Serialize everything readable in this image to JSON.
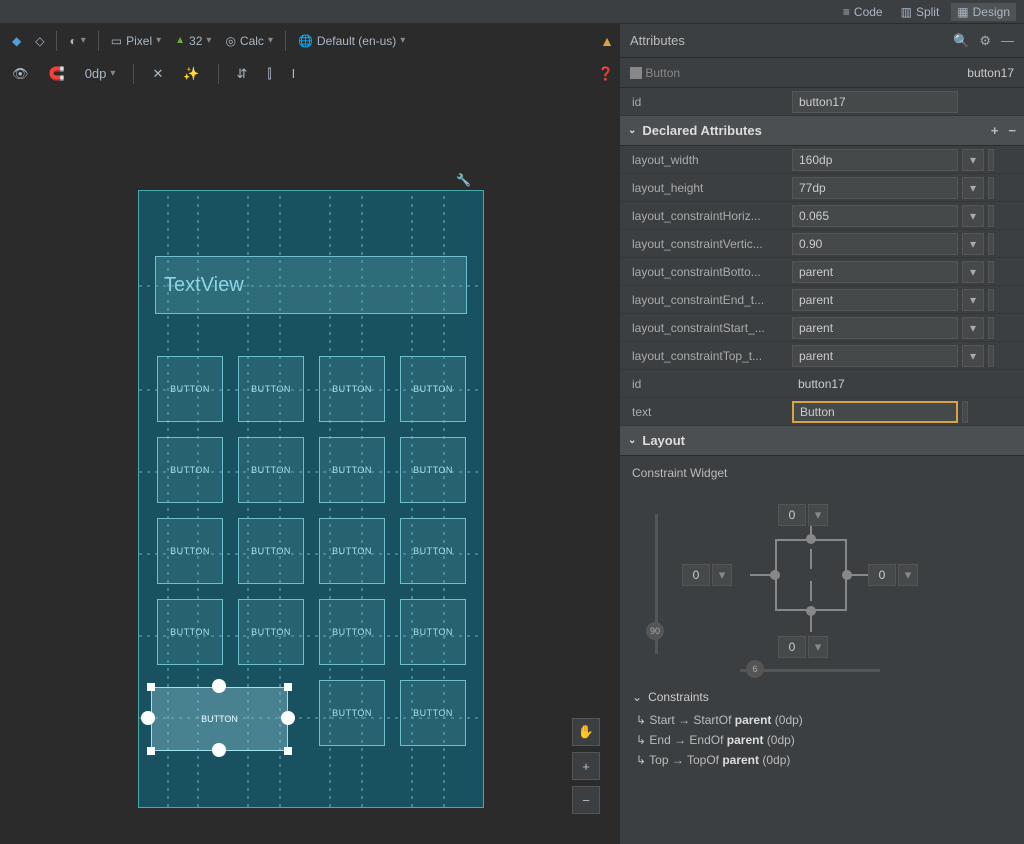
{
  "top_tabs": {
    "code": "Code",
    "split": "Split",
    "design": "Design"
  },
  "toolbar1": {
    "device": "Pixel",
    "api": "32",
    "mode": "Calc",
    "locale": "Default (en-us)"
  },
  "toolbar2": {
    "margin": "0dp"
  },
  "attributes_header": "Attributes",
  "selected": {
    "type": "Button",
    "id_display": "button17"
  },
  "id_label": "id",
  "id_value": "button17",
  "declared_header": "Declared Attributes",
  "attrs": [
    {
      "label": "layout_width",
      "value": "160dp"
    },
    {
      "label": "layout_height",
      "value": "77dp"
    },
    {
      "label": "layout_constraintHoriz...",
      "value": "0.065"
    },
    {
      "label": "layout_constraintVertic...",
      "value": "0.90"
    },
    {
      "label": "layout_constraintBotto...",
      "value": "parent"
    },
    {
      "label": "layout_constraintEnd_t...",
      "value": "parent"
    },
    {
      "label": "layout_constraintStart_...",
      "value": "parent"
    },
    {
      "label": "layout_constraintTop_t...",
      "value": "parent"
    },
    {
      "label": "id",
      "value": "button17",
      "plain": true
    },
    {
      "label": "text",
      "value": "Button",
      "highlight": true
    }
  ],
  "layout_header": "Layout",
  "cw_title": "Constraint Widget",
  "cw_margins": {
    "top": "0",
    "left": "0",
    "right": "0",
    "bottom": "0"
  },
  "cw_bias": {
    "v": "90",
    "h": "6"
  },
  "constraints_header": "Constraints",
  "constraints": [
    {
      "dir": "Start",
      "to": "StartOf",
      "target": "parent",
      "val": "0dp"
    },
    {
      "dir": "End",
      "to": "EndOf",
      "target": "parent",
      "val": "0dp"
    },
    {
      "dir": "Top",
      "to": "TopOf",
      "target": "parent",
      "val": "0dp"
    }
  ],
  "canvas": {
    "textview": "TextView",
    "button_label": "BUTTON"
  }
}
